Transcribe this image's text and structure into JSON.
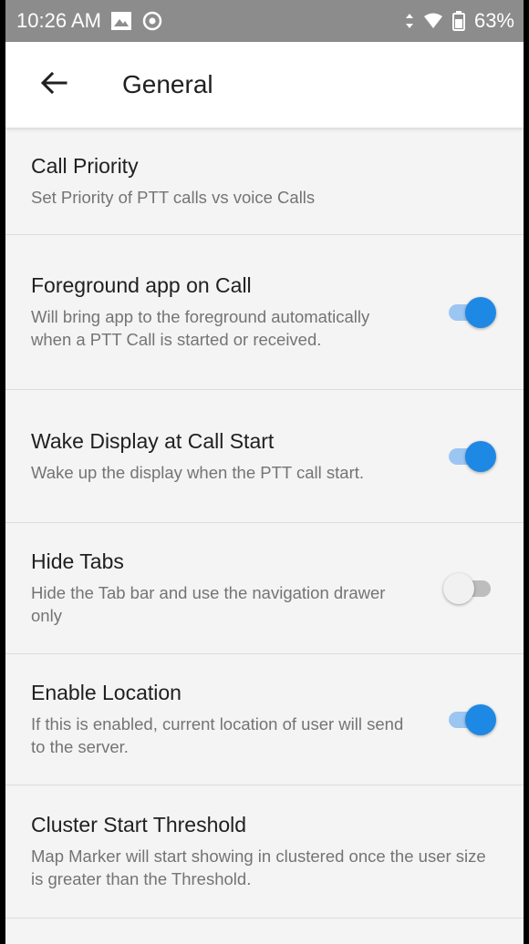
{
  "status_bar": {
    "time": "10:26 AM",
    "battery_percent": "63%",
    "icons": [
      "gallery-icon",
      "sync-icon",
      "data-arrows-icon",
      "wifi-icon",
      "battery-icon"
    ]
  },
  "app_bar": {
    "back_icon": "arrow-left-icon",
    "title": "General"
  },
  "settings": [
    {
      "title": "Call Priority",
      "summary": "Set Priority of PTT calls vs voice Calls",
      "has_toggle": false
    },
    {
      "title": "Foreground app on Call",
      "summary": "Will bring app to the foreground automatically when a PTT Call is started or received.",
      "has_toggle": true,
      "toggle_on": true
    },
    {
      "title": "Wake Display at Call Start",
      "summary": "Wake up the display when the PTT call start.",
      "has_toggle": true,
      "toggle_on": true
    },
    {
      "title": "Hide Tabs",
      "summary": "Hide the Tab bar and use the navigation drawer only",
      "has_toggle": true,
      "toggle_on": false
    },
    {
      "title": "Enable Location",
      "summary": "If this is enabled, current location of user will send to the server.",
      "has_toggle": true,
      "toggle_on": true
    },
    {
      "title": "Cluster Start Threshold",
      "summary": "Map Marker will start showing in clustered once the user size is greater than the Threshold.",
      "has_toggle": false
    }
  ],
  "colors": {
    "accent": "#1e88e5",
    "accent_track": "#9cc6f2",
    "status_bar": "#8c8c8c"
  }
}
